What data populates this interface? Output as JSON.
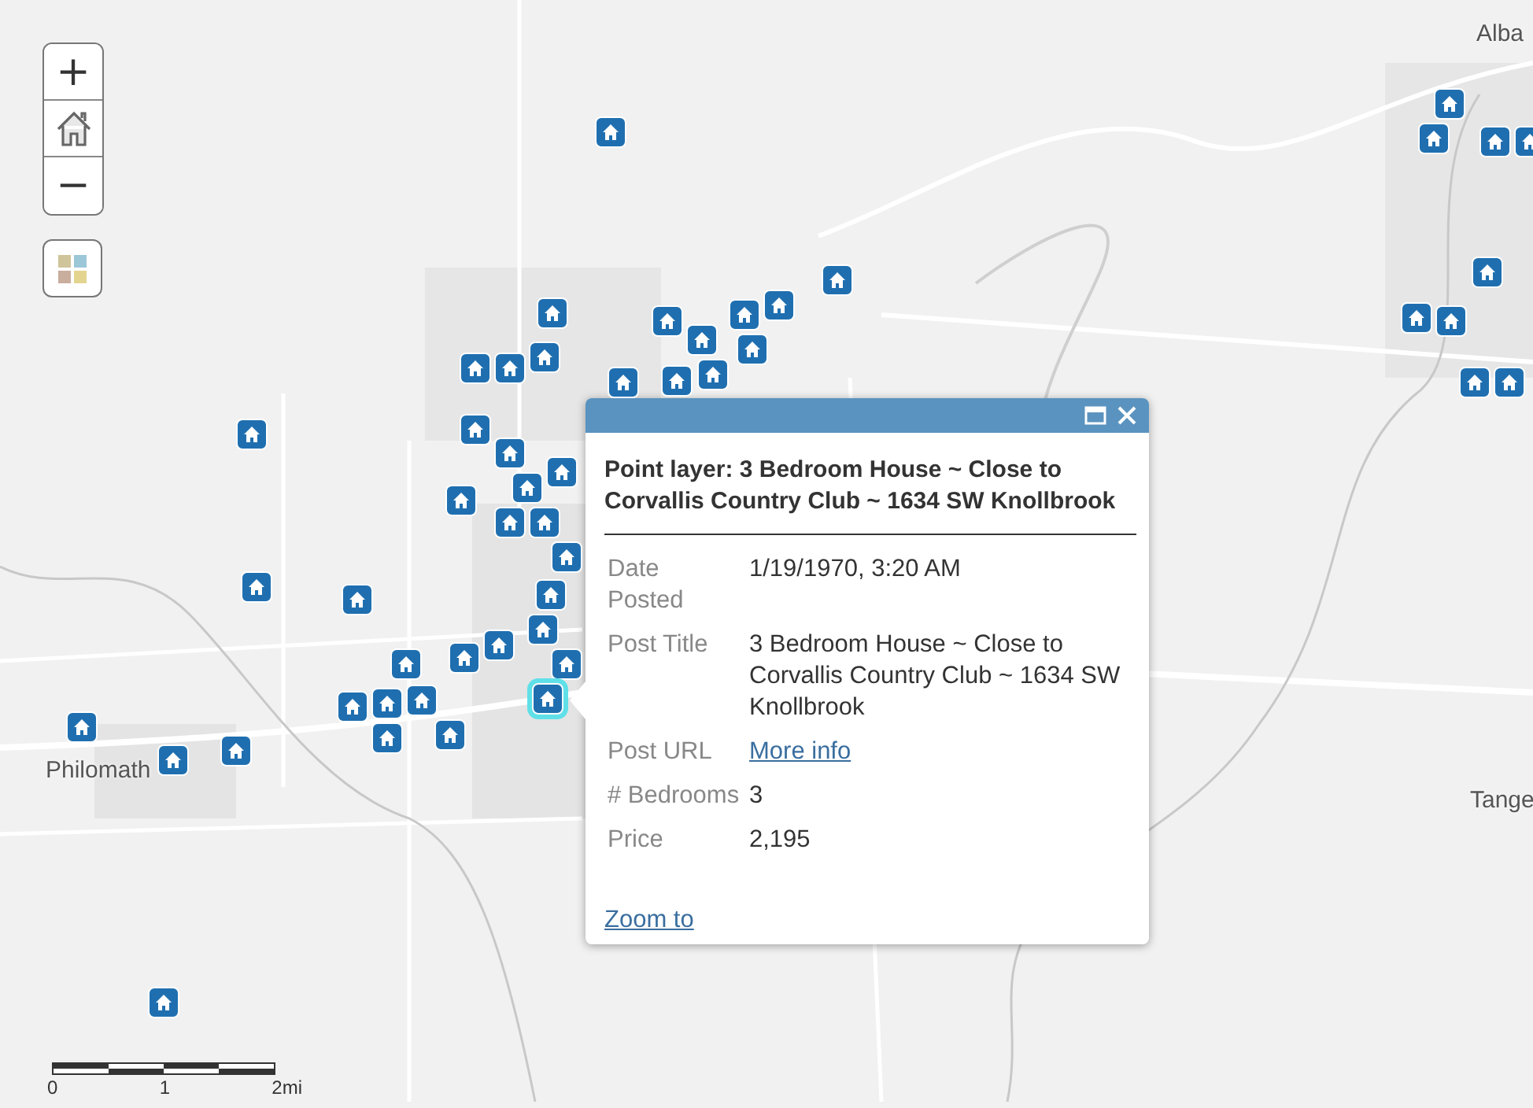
{
  "map_labels": [
    "Alba",
    "Philomath",
    "Tange"
  ],
  "zoom_controls": {
    "zoom_in": "+",
    "zoom_out": "−"
  },
  "markers": [
    {
      "selected": false
    },
    {
      "selected": false
    },
    {
      "selected": false
    },
    {
      "selected": false
    },
    {
      "selected": false
    },
    {
      "selected": false
    },
    {
      "selected": false
    },
    {
      "selected": false
    },
    {
      "selected": false
    },
    {
      "selected": false
    },
    {
      "selected": false
    },
    {
      "selected": false
    },
    {
      "selected": false
    },
    {
      "selected": false
    },
    {
      "selected": false
    },
    {
      "selected": false
    },
    {
      "selected": false
    },
    {
      "selected": false
    },
    {
      "selected": false
    },
    {
      "selected": false
    },
    {
      "selected": false
    },
    {
      "selected": false
    },
    {
      "selected": false
    },
    {
      "selected": false
    },
    {
      "selected": false
    },
    {
      "selected": false
    },
    {
      "selected": false
    },
    {
      "selected": false
    },
    {
      "selected": false
    },
    {
      "selected": false
    },
    {
      "selected": false
    },
    {
      "selected": false
    },
    {
      "selected": false
    },
    {
      "selected": false
    },
    {
      "selected": false
    },
    {
      "selected": false
    },
    {
      "selected": false
    },
    {
      "selected": false
    },
    {
      "selected": false
    },
    {
      "selected": false
    },
    {
      "selected": false
    },
    {
      "selected": false
    },
    {
      "selected": false
    },
    {
      "selected": false
    },
    {
      "selected": false
    },
    {
      "selected": true
    },
    {
      "selected": false
    },
    {
      "selected": false
    },
    {
      "selected": false
    },
    {
      "selected": false
    }
  ],
  "popup": {
    "title": "Point layer: 3 Bedroom House ~ Close to Corvallis Country Club ~ 1634 SW Knollbrook",
    "fields": [
      {
        "label": "Date Posted",
        "value": "1/19/1970, 3:20 AM",
        "kind": "text"
      },
      {
        "label": "Post Title",
        "value": "3 Bedroom House ~ Close to Corvallis Country Club ~ 1634 SW Knollbrook",
        "kind": "text"
      },
      {
        "label": "Post URL",
        "value": "More info",
        "kind": "link"
      },
      {
        "label": "# Bedrooms",
        "value": "3",
        "kind": "text"
      },
      {
        "label": "Price",
        "value": "2,195",
        "kind": "text"
      }
    ],
    "action": "Zoom to"
  },
  "scale_bar": {
    "ticks": [
      "0",
      "1",
      "2mi"
    ]
  }
}
